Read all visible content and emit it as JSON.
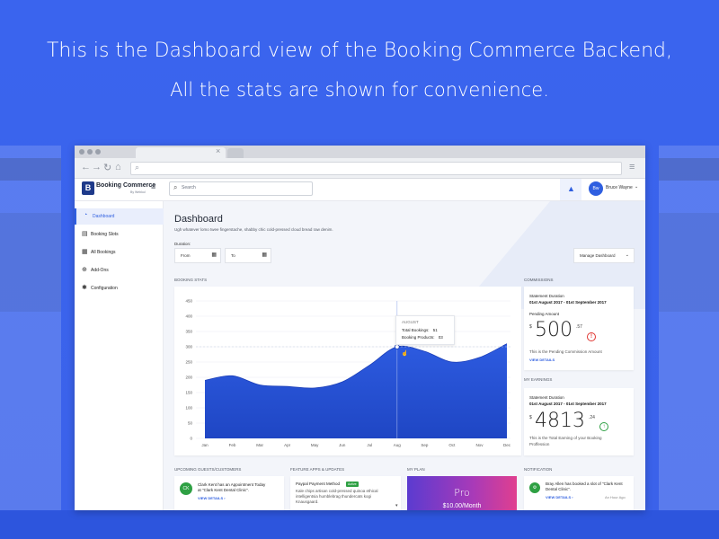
{
  "headline": {
    "line1": "This is the Dashboard view of the Booking Commerce Backend,",
    "line2": "All the stats are shown for convenience."
  },
  "colors": {
    "accent": "#2f5fe0",
    "background": "#3a63ec",
    "chart_fill": "#2d5be0",
    "positive": "#2ea043",
    "negative": "#e0342f"
  },
  "browser": {
    "tab_close": "×",
    "nav_icons": [
      "back-arrow-icon",
      "forward-arrow-icon",
      "reload-icon",
      "home-icon"
    ],
    "menu_icon": "≡"
  },
  "header": {
    "brand": "Booking Commerce",
    "brand_sub": "By Webkul",
    "search_placeholder": "Search",
    "user_initials": "Bw",
    "user_name": "Bruce Wayne"
  },
  "sidebar": {
    "items": [
      {
        "label": "Dashboard",
        "icon": "dashboard-icon",
        "active": true
      },
      {
        "label": "Booking Slots",
        "icon": "booking-slots-icon",
        "active": false
      },
      {
        "label": "All Bookings",
        "icon": "bookings-list-icon",
        "active": false
      },
      {
        "label": "Add-Ons",
        "icon": "add-ons-icon",
        "active": false
      },
      {
        "label": "Configuration",
        "icon": "gear-icon",
        "active": false
      }
    ]
  },
  "main": {
    "title": "Dashboard",
    "subtitle": "Ugh whatever lomo twee fingerstache, shabby chic cold-pressed cloud bread raw denim.",
    "duration_label": "Duration:",
    "from_label": "From",
    "to_label": "To",
    "manage_label": "Manage Dashboard",
    "booking_stats_label": "Booking Stats"
  },
  "chart_data": {
    "type": "area",
    "title": "Booking Stats",
    "categories": [
      "Jan",
      "Feb",
      "Mar",
      "Apr",
      "May",
      "Jun",
      "Jul",
      "Aug",
      "Sep",
      "Oct",
      "Nov",
      "Dec"
    ],
    "values": [
      190,
      205,
      175,
      170,
      165,
      185,
      240,
      300,
      285,
      250,
      265,
      310
    ],
    "yticks": [
      0,
      50,
      100,
      150,
      200,
      250,
      300,
      350,
      400,
      450
    ],
    "ylim": [
      0,
      450
    ],
    "grid": true,
    "highlight": {
      "category": "Aug",
      "value": 300
    }
  },
  "tooltip": {
    "month": "August",
    "total_bookings_label": "Total Bookings:",
    "total_bookings_value": "51",
    "booking_products_label": "Booking Products:",
    "booking_products_value": "03"
  },
  "commissions": {
    "section_label": "Commissions",
    "statement_label": "Statement Duration",
    "statement_range": "01st August 2017 - 01st September 2017",
    "pending_label": "Pending Amount",
    "currency": "$",
    "amount_main": "500",
    "amount_cents": ".57",
    "description": "This is the Pending Commission Amount",
    "link": "VIEW DETAILS"
  },
  "earnings": {
    "section_label": "My Earnings",
    "statement_label": "Statement Duration",
    "statement_range": "01st August 2017 - 01st September 2017",
    "currency": "$",
    "amount_main": "4813",
    "amount_cents": ".24",
    "description_line1": "This is the Total Earning of your Booking",
    "description_line2": "Proffession"
  },
  "bottom": {
    "guests_label": "Upcoming Guests/Customers",
    "guest_initials": "CK",
    "guest_text_line1": "Clark Kent has an Appointment Today",
    "guest_text_line2": "at \"Clark Kent Dental Clinic\".",
    "guest_link": "VIEW DETAILS",
    "feature_label": "Feature Apps & Updates",
    "feature_title": "Paypal Payment Method",
    "feature_badge": "Active",
    "feature_text_line1": "Kale chips artisan cold-pressed quinoa ethical",
    "feature_text_line2": "intelligentsia humblebrag thundercats kogi",
    "feature_text_line3": "Knausgaard.",
    "plan_label": "My Plan",
    "plan_name": "Pro",
    "plan_price": "$10.00/Month",
    "notification_label": "Notification",
    "notification_text_line1": "Bray Allen has booked a slot of \"Clark Kent",
    "notification_text_line2": "Dental Clinic\".",
    "notification_link": "VIEW DETAILS",
    "notification_time": "An Hour Ago"
  }
}
